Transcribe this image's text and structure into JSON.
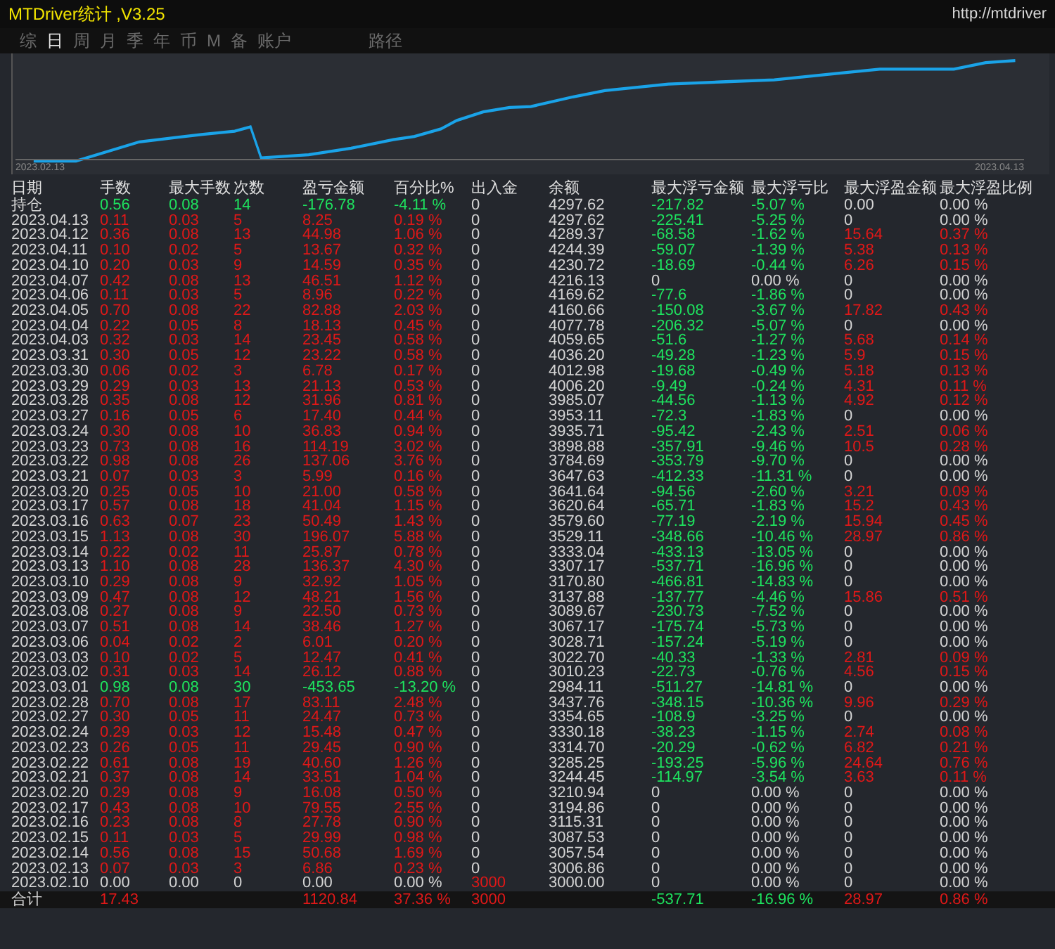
{
  "window": {
    "title": "MTDriver统计 ,V3.25",
    "url": "http://mtdriver"
  },
  "tabs": [
    {
      "label": "综",
      "selected": false
    },
    {
      "label": "日",
      "selected": true
    },
    {
      "label": "周",
      "selected": false
    },
    {
      "label": "月",
      "selected": false
    },
    {
      "label": "季",
      "selected": false
    },
    {
      "label": "年",
      "selected": false
    },
    {
      "label": "币",
      "selected": false
    },
    {
      "label": "M",
      "selected": false
    },
    {
      "label": "备",
      "selected": false
    },
    {
      "label": "账户",
      "selected": false
    },
    {
      "label": "路径",
      "selected": false
    }
  ],
  "chart": {
    "start_label": "2023.02.13",
    "end_label": "2023.04.13"
  },
  "table": {
    "columns": [
      "日期",
      "手数",
      "最大手数",
      "次数",
      "盈亏金额",
      "百分比%",
      "出入金",
      "余额",
      "最大浮亏金额",
      "最大浮亏比",
      "最大浮盈金额",
      "最大浮盈比例"
    ],
    "rows": [
      {
        "date": "持仓",
        "values": [
          "0.56",
          "0.08",
          "14",
          "-176.78",
          "-4.11 %",
          "0",
          "4297.62",
          "-217.82",
          "-5.07 %",
          "0.00",
          "0.00 %"
        ],
        "profit": false,
        "loss": true,
        "float_loss": true,
        "float_profit": false,
        "deposit_move": false
      },
      {
        "date": "2023.04.13",
        "values": [
          "0.11",
          "0.03",
          "5",
          "8.25",
          "0.19 %",
          "0",
          "4297.62",
          "-225.41",
          "-5.25 %",
          "0",
          "0.00 %"
        ],
        "profit": true,
        "loss": false,
        "float_loss": true,
        "float_profit": false,
        "deposit_move": false
      },
      {
        "date": "2023.04.12",
        "values": [
          "0.36",
          "0.08",
          "13",
          "44.98",
          "1.06 %",
          "0",
          "4289.37",
          "-68.58",
          "-1.62 %",
          "15.64",
          "0.37 %"
        ],
        "profit": true,
        "loss": false,
        "float_loss": true,
        "float_profit": true,
        "deposit_move": false
      },
      {
        "date": "2023.04.11",
        "values": [
          "0.10",
          "0.02",
          "5",
          "13.67",
          "0.32 %",
          "0",
          "4244.39",
          "-59.07",
          "-1.39 %",
          "5.38",
          "0.13 %"
        ],
        "profit": true,
        "loss": false,
        "float_loss": true,
        "float_profit": true,
        "deposit_move": false
      },
      {
        "date": "2023.04.10",
        "values": [
          "0.20",
          "0.03",
          "9",
          "14.59",
          "0.35 %",
          "0",
          "4230.72",
          "-18.69",
          "-0.44 %",
          "6.26",
          "0.15 %"
        ],
        "profit": true,
        "loss": false,
        "float_loss": true,
        "float_profit": true,
        "deposit_move": false
      },
      {
        "date": "2023.04.07",
        "values": [
          "0.42",
          "0.08",
          "13",
          "46.51",
          "1.12 %",
          "0",
          "4216.13",
          "0",
          "0.00 %",
          "0",
          "0.00 %"
        ],
        "profit": true,
        "loss": false,
        "float_loss": false,
        "float_profit": false,
        "deposit_move": false
      },
      {
        "date": "2023.04.06",
        "values": [
          "0.11",
          "0.03",
          "5",
          "8.96",
          "0.22 %",
          "0",
          "4169.62",
          "-77.6",
          "-1.86 %",
          "0",
          "0.00 %"
        ],
        "profit": true,
        "loss": false,
        "float_loss": true,
        "float_profit": false,
        "deposit_move": false
      },
      {
        "date": "2023.04.05",
        "values": [
          "0.70",
          "0.08",
          "22",
          "82.88",
          "2.03 %",
          "0",
          "4160.66",
          "-150.08",
          "-3.67 %",
          "17.82",
          "0.43 %"
        ],
        "profit": true,
        "loss": false,
        "float_loss": true,
        "float_profit": true,
        "deposit_move": false
      },
      {
        "date": "2023.04.04",
        "values": [
          "0.22",
          "0.05",
          "8",
          "18.13",
          "0.45 %",
          "0",
          "4077.78",
          "-206.32",
          "-5.07 %",
          "0",
          "0.00 %"
        ],
        "profit": true,
        "loss": false,
        "float_loss": true,
        "float_profit": false,
        "deposit_move": false
      },
      {
        "date": "2023.04.03",
        "values": [
          "0.32",
          "0.03",
          "14",
          "23.45",
          "0.58 %",
          "0",
          "4059.65",
          "-51.6",
          "-1.27 %",
          "5.68",
          "0.14 %"
        ],
        "profit": true,
        "loss": false,
        "float_loss": true,
        "float_profit": true,
        "deposit_move": false
      },
      {
        "date": "2023.03.31",
        "values": [
          "0.30",
          "0.05",
          "12",
          "23.22",
          "0.58 %",
          "0",
          "4036.20",
          "-49.28",
          "-1.23 %",
          "5.9",
          "0.15 %"
        ],
        "profit": true,
        "loss": false,
        "float_loss": true,
        "float_profit": true,
        "deposit_move": false
      },
      {
        "date": "2023.03.30",
        "values": [
          "0.06",
          "0.02",
          "3",
          "6.78",
          "0.17 %",
          "0",
          "4012.98",
          "-19.68",
          "-0.49 %",
          "5.18",
          "0.13 %"
        ],
        "profit": true,
        "loss": false,
        "float_loss": true,
        "float_profit": true,
        "deposit_move": false
      },
      {
        "date": "2023.03.29",
        "values": [
          "0.29",
          "0.03",
          "13",
          "21.13",
          "0.53 %",
          "0",
          "4006.20",
          "-9.49",
          "-0.24 %",
          "4.31",
          "0.11 %"
        ],
        "profit": true,
        "loss": false,
        "float_loss": true,
        "float_profit": true,
        "deposit_move": false
      },
      {
        "date": "2023.03.28",
        "values": [
          "0.35",
          "0.08",
          "12",
          "31.96",
          "0.81 %",
          "0",
          "3985.07",
          "-44.56",
          "-1.13 %",
          "4.92",
          "0.12 %"
        ],
        "profit": true,
        "loss": false,
        "float_loss": true,
        "float_profit": true,
        "deposit_move": false
      },
      {
        "date": "2023.03.27",
        "values": [
          "0.16",
          "0.05",
          "6",
          "17.40",
          "0.44 %",
          "0",
          "3953.11",
          "-72.3",
          "-1.83 %",
          "0",
          "0.00 %"
        ],
        "profit": true,
        "loss": false,
        "float_loss": true,
        "float_profit": false,
        "deposit_move": false
      },
      {
        "date": "2023.03.24",
        "values": [
          "0.30",
          "0.08",
          "10",
          "36.83",
          "0.94 %",
          "0",
          "3935.71",
          "-95.42",
          "-2.43 %",
          "2.51",
          "0.06 %"
        ],
        "profit": true,
        "loss": false,
        "float_loss": true,
        "float_profit": true,
        "deposit_move": false
      },
      {
        "date": "2023.03.23",
        "values": [
          "0.73",
          "0.08",
          "16",
          "114.19",
          "3.02 %",
          "0",
          "3898.88",
          "-357.91",
          "-9.46 %",
          "10.5",
          "0.28 %"
        ],
        "profit": true,
        "loss": false,
        "float_loss": true,
        "float_profit": true,
        "deposit_move": false
      },
      {
        "date": "2023.03.22",
        "values": [
          "0.98",
          "0.08",
          "26",
          "137.06",
          "3.76 %",
          "0",
          "3784.69",
          "-353.79",
          "-9.70 %",
          "0",
          "0.00 %"
        ],
        "profit": true,
        "loss": false,
        "float_loss": true,
        "float_profit": false,
        "deposit_move": false
      },
      {
        "date": "2023.03.21",
        "values": [
          "0.07",
          "0.03",
          "3",
          "5.99",
          "0.16 %",
          "0",
          "3647.63",
          "-412.33",
          "-11.31 %",
          "0",
          "0.00 %"
        ],
        "profit": true,
        "loss": false,
        "float_loss": true,
        "float_profit": false,
        "deposit_move": false
      },
      {
        "date": "2023.03.20",
        "values": [
          "0.25",
          "0.05",
          "10",
          "21.00",
          "0.58 %",
          "0",
          "3641.64",
          "-94.56",
          "-2.60 %",
          "3.21",
          "0.09 %"
        ],
        "profit": true,
        "loss": false,
        "float_loss": true,
        "float_profit": true,
        "deposit_move": false
      },
      {
        "date": "2023.03.17",
        "values": [
          "0.57",
          "0.08",
          "18",
          "41.04",
          "1.15 %",
          "0",
          "3620.64",
          "-65.71",
          "-1.83 %",
          "15.2",
          "0.43 %"
        ],
        "profit": true,
        "loss": false,
        "float_loss": true,
        "float_profit": true,
        "deposit_move": false
      },
      {
        "date": "2023.03.16",
        "values": [
          "0.63",
          "0.07",
          "23",
          "50.49",
          "1.43 %",
          "0",
          "3579.60",
          "-77.19",
          "-2.19 %",
          "15.94",
          "0.45 %"
        ],
        "profit": true,
        "loss": false,
        "float_loss": true,
        "float_profit": true,
        "deposit_move": false
      },
      {
        "date": "2023.03.15",
        "values": [
          "1.13",
          "0.08",
          "30",
          "196.07",
          "5.88 %",
          "0",
          "3529.11",
          "-348.66",
          "-10.46 %",
          "28.97",
          "0.86 %"
        ],
        "profit": true,
        "loss": false,
        "float_loss": true,
        "float_profit": true,
        "deposit_move": false
      },
      {
        "date": "2023.03.14",
        "values": [
          "0.22",
          "0.02",
          "11",
          "25.87",
          "0.78 %",
          "0",
          "3333.04",
          "-433.13",
          "-13.05 %",
          "0",
          "0.00 %"
        ],
        "profit": true,
        "loss": false,
        "float_loss": true,
        "float_profit": false,
        "deposit_move": false
      },
      {
        "date": "2023.03.13",
        "values": [
          "1.10",
          "0.08",
          "28",
          "136.37",
          "4.30 %",
          "0",
          "3307.17",
          "-537.71",
          "-16.96 %",
          "0",
          "0.00 %"
        ],
        "profit": true,
        "loss": false,
        "float_loss": true,
        "float_profit": false,
        "deposit_move": false
      },
      {
        "date": "2023.03.10",
        "values": [
          "0.29",
          "0.08",
          "9",
          "32.92",
          "1.05 %",
          "0",
          "3170.80",
          "-466.81",
          "-14.83 %",
          "0",
          "0.00 %"
        ],
        "profit": true,
        "loss": false,
        "float_loss": true,
        "float_profit": false,
        "deposit_move": false
      },
      {
        "date": "2023.03.09",
        "values": [
          "0.47",
          "0.08",
          "12",
          "48.21",
          "1.56 %",
          "0",
          "3137.88",
          "-137.77",
          "-4.46 %",
          "15.86",
          "0.51 %"
        ],
        "profit": true,
        "loss": false,
        "float_loss": true,
        "float_profit": true,
        "deposit_move": false
      },
      {
        "date": "2023.03.08",
        "values": [
          "0.27",
          "0.08",
          "9",
          "22.50",
          "0.73 %",
          "0",
          "3089.67",
          "-230.73",
          "-7.52 %",
          "0",
          "0.00 %"
        ],
        "profit": true,
        "loss": false,
        "float_loss": true,
        "float_profit": false,
        "deposit_move": false
      },
      {
        "date": "2023.03.07",
        "values": [
          "0.51",
          "0.08",
          "14",
          "38.46",
          "1.27 %",
          "0",
          "3067.17",
          "-175.74",
          "-5.73 %",
          "0",
          "0.00 %"
        ],
        "profit": true,
        "loss": false,
        "float_loss": true,
        "float_profit": false,
        "deposit_move": false
      },
      {
        "date": "2023.03.06",
        "values": [
          "0.04",
          "0.02",
          "2",
          "6.01",
          "0.20 %",
          "0",
          "3028.71",
          "-157.24",
          "-5.19 %",
          "0",
          "0.00 %"
        ],
        "profit": true,
        "loss": false,
        "float_loss": true,
        "float_profit": false,
        "deposit_move": false
      },
      {
        "date": "2023.03.03",
        "values": [
          "0.10",
          "0.02",
          "5",
          "12.47",
          "0.41 %",
          "0",
          "3022.70",
          "-40.33",
          "-1.33 %",
          "2.81",
          "0.09 %"
        ],
        "profit": true,
        "loss": false,
        "float_loss": true,
        "float_profit": true,
        "deposit_move": false
      },
      {
        "date": "2023.03.02",
        "values": [
          "0.31",
          "0.03",
          "14",
          "26.12",
          "0.88 %",
          "0",
          "3010.23",
          "-22.73",
          "-0.76 %",
          "4.56",
          "0.15 %"
        ],
        "profit": true,
        "loss": false,
        "float_loss": true,
        "float_profit": true,
        "deposit_move": false
      },
      {
        "date": "2023.03.01",
        "values": [
          "0.98",
          "0.08",
          "30",
          "-453.65",
          "-13.20 %",
          "0",
          "2984.11",
          "-511.27",
          "-14.81 %",
          "0",
          "0.00 %"
        ],
        "profit": false,
        "loss": true,
        "float_loss": true,
        "float_profit": false,
        "deposit_move": false
      },
      {
        "date": "2023.02.28",
        "values": [
          "0.70",
          "0.08",
          "17",
          "83.11",
          "2.48 %",
          "0",
          "3437.76",
          "-348.15",
          "-10.36 %",
          "9.96",
          "0.29 %"
        ],
        "profit": true,
        "loss": false,
        "float_loss": true,
        "float_profit": true,
        "deposit_move": false
      },
      {
        "date": "2023.02.27",
        "values": [
          "0.30",
          "0.05",
          "11",
          "24.47",
          "0.73 %",
          "0",
          "3354.65",
          "-108.9",
          "-3.25 %",
          "0",
          "0.00 %"
        ],
        "profit": true,
        "loss": false,
        "float_loss": true,
        "float_profit": false,
        "deposit_move": false
      },
      {
        "date": "2023.02.24",
        "values": [
          "0.29",
          "0.03",
          "12",
          "15.48",
          "0.47 %",
          "0",
          "3330.18",
          "-38.23",
          "-1.15 %",
          "2.74",
          "0.08 %"
        ],
        "profit": true,
        "loss": false,
        "float_loss": true,
        "float_profit": true,
        "deposit_move": false
      },
      {
        "date": "2023.02.23",
        "values": [
          "0.26",
          "0.05",
          "11",
          "29.45",
          "0.90 %",
          "0",
          "3314.70",
          "-20.29",
          "-0.62 %",
          "6.82",
          "0.21 %"
        ],
        "profit": true,
        "loss": false,
        "float_loss": true,
        "float_profit": true,
        "deposit_move": false
      },
      {
        "date": "2023.02.22",
        "values": [
          "0.61",
          "0.08",
          "19",
          "40.60",
          "1.26 %",
          "0",
          "3285.25",
          "-193.25",
          "-5.96 %",
          "24.64",
          "0.76 %"
        ],
        "profit": true,
        "loss": false,
        "float_loss": true,
        "float_profit": true,
        "deposit_move": false
      },
      {
        "date": "2023.02.21",
        "values": [
          "0.37",
          "0.08",
          "14",
          "33.51",
          "1.04 %",
          "0",
          "3244.45",
          "-114.97",
          "-3.54 %",
          "3.63",
          "0.11 %"
        ],
        "profit": true,
        "loss": false,
        "float_loss": true,
        "float_profit": true,
        "deposit_move": false
      },
      {
        "date": "2023.02.20",
        "values": [
          "0.29",
          "0.08",
          "9",
          "16.08",
          "0.50 %",
          "0",
          "3210.94",
          "0",
          "0.00 %",
          "0",
          "0.00 %"
        ],
        "profit": true,
        "loss": false,
        "float_loss": false,
        "float_profit": false,
        "deposit_move": false
      },
      {
        "date": "2023.02.17",
        "values": [
          "0.43",
          "0.08",
          "10",
          "79.55",
          "2.55 %",
          "0",
          "3194.86",
          "0",
          "0.00 %",
          "0",
          "0.00 %"
        ],
        "profit": true,
        "loss": false,
        "float_loss": false,
        "float_profit": false,
        "deposit_move": false
      },
      {
        "date": "2023.02.16",
        "values": [
          "0.23",
          "0.08",
          "8",
          "27.78",
          "0.90 %",
          "0",
          "3115.31",
          "0",
          "0.00 %",
          "0",
          "0.00 %"
        ],
        "profit": true,
        "loss": false,
        "float_loss": false,
        "float_profit": false,
        "deposit_move": false
      },
      {
        "date": "2023.02.15",
        "values": [
          "0.11",
          "0.03",
          "5",
          "29.99",
          "0.98 %",
          "0",
          "3087.53",
          "0",
          "0.00 %",
          "0",
          "0.00 %"
        ],
        "profit": true,
        "loss": false,
        "float_loss": false,
        "float_profit": false,
        "deposit_move": false
      },
      {
        "date": "2023.02.14",
        "values": [
          "0.56",
          "0.08",
          "15",
          "50.68",
          "1.69 %",
          "0",
          "3057.54",
          "0",
          "0.00 %",
          "0",
          "0.00 %"
        ],
        "profit": true,
        "loss": false,
        "float_loss": false,
        "float_profit": false,
        "deposit_move": false
      },
      {
        "date": "2023.02.13",
        "values": [
          "0.07",
          "0.03",
          "3",
          "6.86",
          "0.23 %",
          "0",
          "3006.86",
          "0",
          "0.00 %",
          "0",
          "0.00 %"
        ],
        "profit": true,
        "loss": false,
        "float_loss": false,
        "float_profit": false,
        "deposit_move": false
      },
      {
        "date": "2023.02.10",
        "values": [
          "0.00",
          "0.00",
          "0",
          "0.00",
          "0.00 %",
          "3000",
          "3000.00",
          "0",
          "0.00 %",
          "0",
          "0.00 %"
        ],
        "profit": false,
        "loss": false,
        "float_loss": false,
        "float_profit": false,
        "deposit_move": true
      }
    ],
    "totals": {
      "label": "合计",
      "lots": "17.43",
      "pnl": "1120.84",
      "pct": "37.36 %",
      "deposit": "3000",
      "max_float_loss": "-537.71",
      "max_float_loss_pct": "-16.96 %",
      "max_float_profit": "28.97",
      "max_float_profit_pct": "0.86 %"
    }
  }
}
